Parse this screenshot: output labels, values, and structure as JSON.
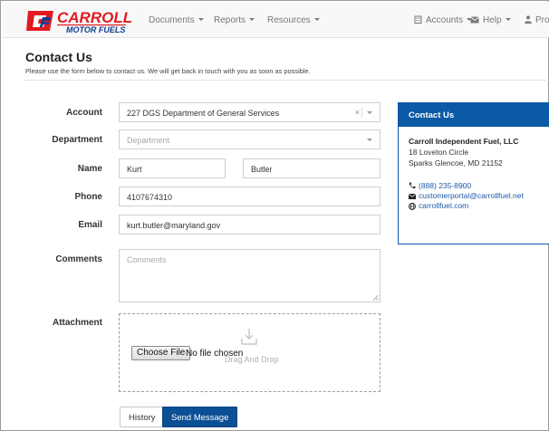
{
  "brand": {
    "name": "CARROLL",
    "tagline": "MOTOR FUELS",
    "colors": {
      "red": "#e11b22",
      "blue": "#0b3d91"
    }
  },
  "nav": {
    "left": [
      {
        "label": "Documents"
      },
      {
        "label": "Reports"
      },
      {
        "label": "Resources"
      }
    ],
    "right": [
      {
        "label": "Accounts",
        "icon": "building-icon"
      },
      {
        "label": "Help",
        "icon": "envelope-icon"
      },
      {
        "label": "Prof",
        "icon": "user-icon"
      }
    ]
  },
  "page": {
    "title": "Contact Us",
    "subtitle": "Please use the form below to contact us. We will get back in touch with you as soon as possible."
  },
  "form": {
    "account": {
      "label": "Account",
      "value": "227 DGS Department of General Services",
      "clear": "×"
    },
    "department": {
      "label": "Department",
      "placeholder": "Department"
    },
    "name": {
      "label": "Name",
      "first": "Kurt",
      "last": "Butler"
    },
    "phone": {
      "label": "Phone",
      "value": "4107674310"
    },
    "email": {
      "label": "Email",
      "value": "kurt.butler@maryland.gov"
    },
    "comments": {
      "label": "Comments",
      "placeholder": "Comments"
    },
    "attachment": {
      "label": "Attachment",
      "choose_label": "Choose File",
      "file_status": "No file chosen",
      "drop_text": "Drag And Drop"
    }
  },
  "actions": {
    "history": "History",
    "send": "Send Message"
  },
  "contact_panel": {
    "title": "Contact Us",
    "company": "Carroll Independent Fuel, LLC",
    "address1": "18 Loveton Circle",
    "address2": "Sparks Glencoe, MD 21152",
    "phone": "(888) 235-8900",
    "email": "customerportal@carrollfuel.net",
    "website": "carrollfuel.com",
    "accent": "#0b5aa6"
  }
}
